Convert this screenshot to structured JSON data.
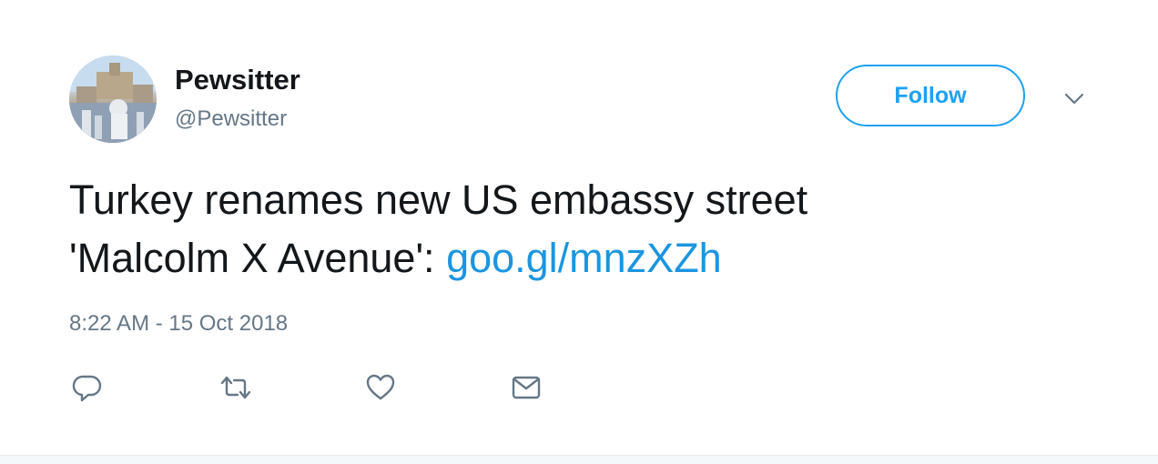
{
  "user": {
    "name": "Pewsitter",
    "handle": "@Pewsitter",
    "avatar_icon": "avatar-photo"
  },
  "header": {
    "follow_label": "Follow",
    "menu_icon": "chevron-down-icon"
  },
  "tweet": {
    "text_line1": "Turkey renames new US embassy street",
    "text_line2": "'Malcolm X Avenue': ",
    "link": "goo.gl/mnzXZh",
    "timestamp": "8:22 AM - 15 Oct 2018"
  },
  "actions": [
    {
      "icon": "reply-icon"
    },
    {
      "icon": "retweet-icon"
    },
    {
      "icon": "like-icon"
    },
    {
      "icon": "direct-message-icon"
    }
  ],
  "colors": {
    "accent": "#1da1f2",
    "link": "#1b95e0",
    "text": "#14171a",
    "secondary": "#657786"
  }
}
